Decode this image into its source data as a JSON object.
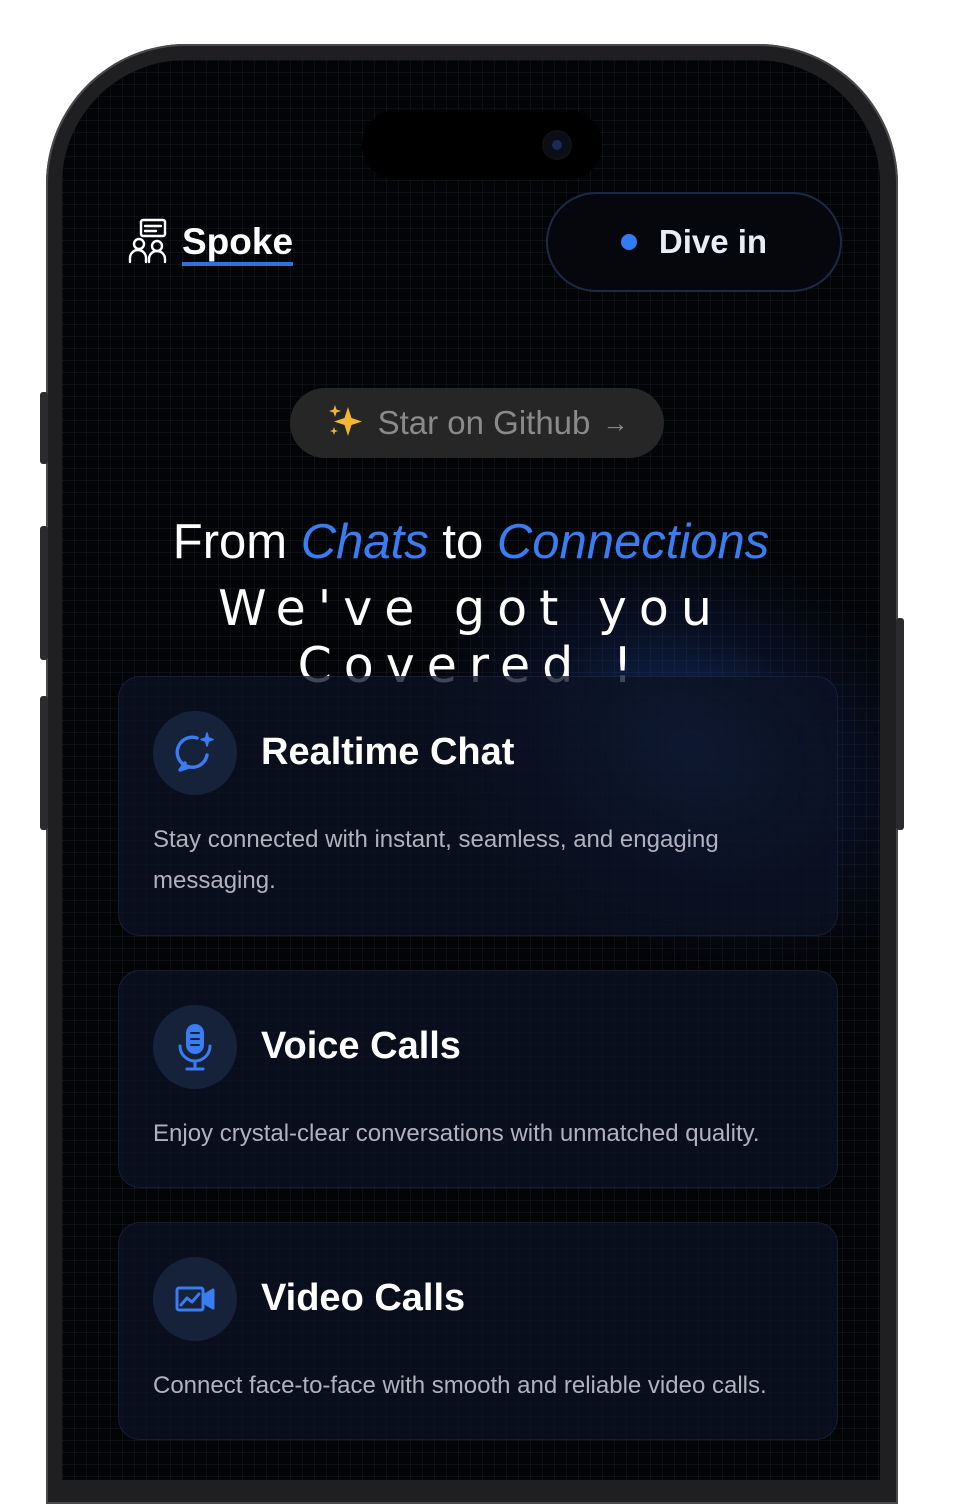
{
  "header": {
    "logo_text": "Spoke",
    "logo_icon": "users-chat-icon",
    "cta_label": "Dive in"
  },
  "hero": {
    "badge_label": "Star on Github",
    "badge_icon": "sparkles-icon",
    "badge_arrow": "→",
    "headline_part1": "From ",
    "headline_accent1": "Chats",
    "headline_part2": " to ",
    "headline_accent2": "Connections",
    "subheadline": "We've got you Covered !"
  },
  "features": [
    {
      "title": "Realtime Chat",
      "description": "Stay connected with instant, seamless, and engaging messaging.",
      "icon": "chat-sparkle-icon"
    },
    {
      "title": "Voice Calls",
      "description": "Enjoy crystal-clear conversations with unmatched quality.",
      "icon": "microphone-icon"
    },
    {
      "title": "Video Calls",
      "description": "Connect face-to-face with smooth and reliable video calls.",
      "icon": "video-camera-icon"
    }
  ],
  "colors": {
    "accent": "#3a7df0",
    "background": "#030406",
    "card": "#0c1222",
    "star": "#f2b632"
  }
}
